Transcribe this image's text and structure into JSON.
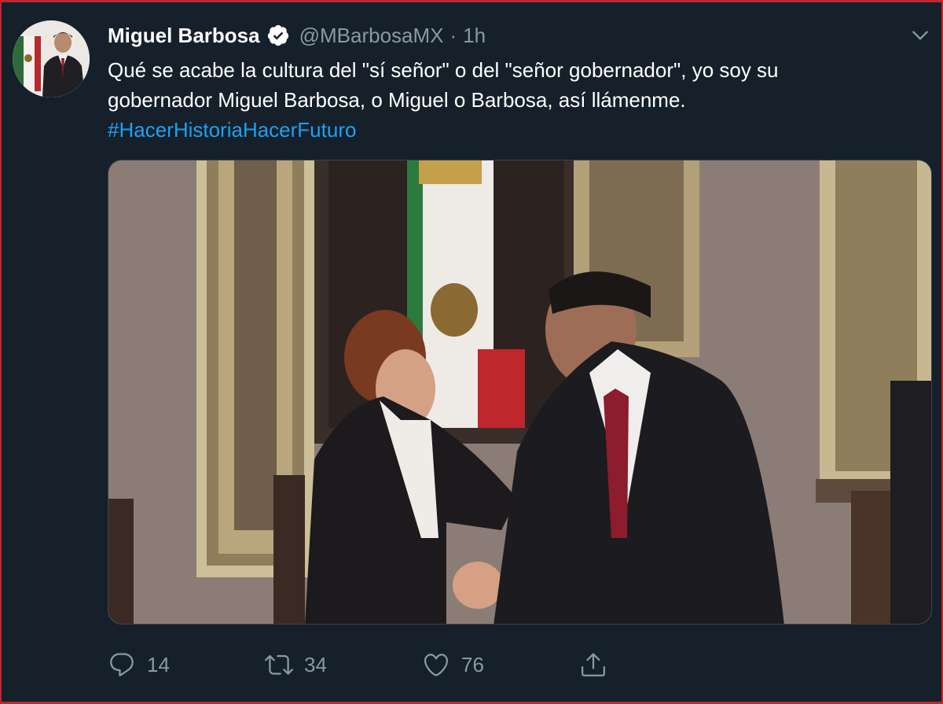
{
  "tweet": {
    "author_name": "Miguel Barbosa",
    "handle": "@MBarbosaMX",
    "separator": "·",
    "time": "1h",
    "text_line1": "Qué se acabe la cultura del \"sí señor\" o del \"señor gobernador\", yo soy su",
    "text_line2": "gobernador Miguel Barbosa, o Miguel o Barbosa, así llámenme.",
    "hashtag": "#HacerHistoriaHacerFuturo"
  },
  "actions": {
    "replies": "14",
    "retweets": "34",
    "likes": "76"
  },
  "icons": {
    "verified": "verified-badge-icon",
    "caret": "chevron-down-icon",
    "reply": "reply-icon",
    "retweet": "retweet-icon",
    "like": "heart-icon",
    "share": "share-icon"
  },
  "colors": {
    "background": "#15202b",
    "text": "#ffffff",
    "muted": "#8899a6",
    "link": "#1da1f2",
    "frame": "#c0262d"
  }
}
